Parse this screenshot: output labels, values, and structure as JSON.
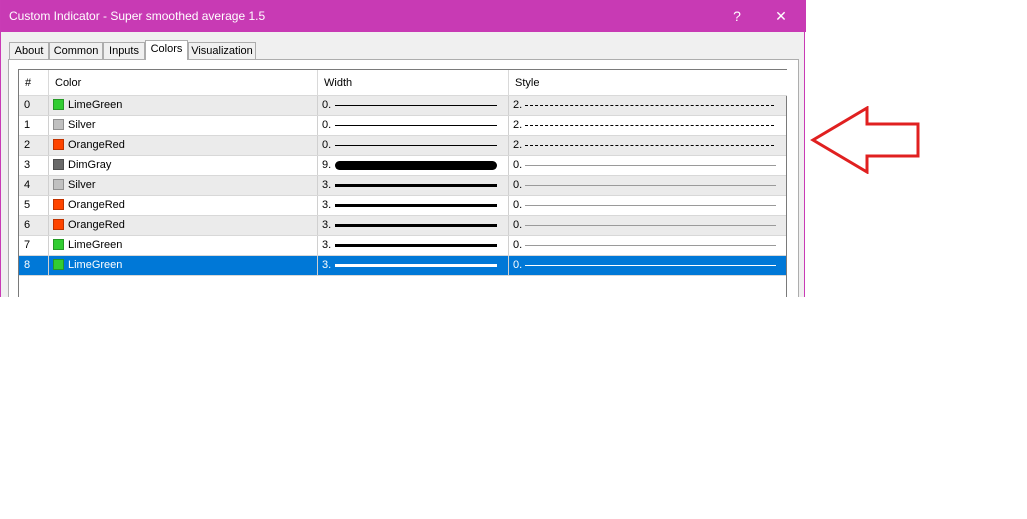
{
  "window": {
    "title": "Custom Indicator - Super smoothed average 1.5",
    "help_label": "?",
    "close_label": "✕"
  },
  "tabs": [
    {
      "label": "About"
    },
    {
      "label": "Common"
    },
    {
      "label": "Inputs"
    },
    {
      "label": "Colors"
    },
    {
      "label": "Visualization"
    }
  ],
  "active_tab": "Colors",
  "table": {
    "headers": [
      "#",
      "Color",
      "Width",
      "Style"
    ],
    "rows": [
      {
        "index": "0",
        "color_name": "LimeGreen",
        "color_hex": "#32cd32",
        "width": "0.",
        "style": "2."
      },
      {
        "index": "1",
        "color_name": "Silver",
        "color_hex": "#c0c0c0",
        "width": "0.",
        "style": "2."
      },
      {
        "index": "2",
        "color_name": "OrangeRed",
        "color_hex": "#ff4500",
        "width": "0.",
        "style": "2."
      },
      {
        "index": "3",
        "color_name": "DimGray",
        "color_hex": "#696969",
        "width": "9.",
        "style": "0."
      },
      {
        "index": "4",
        "color_name": "Silver",
        "color_hex": "#c0c0c0",
        "width": "3.",
        "style": "0."
      },
      {
        "index": "5",
        "color_name": "OrangeRed",
        "color_hex": "#ff4500",
        "width": "3.",
        "style": "0."
      },
      {
        "index": "6",
        "color_name": "OrangeRed",
        "color_hex": "#ff4500",
        "width": "3.",
        "style": "0."
      },
      {
        "index": "7",
        "color_name": "LimeGreen",
        "color_hex": "#32cd32",
        "width": "3.",
        "style": "0."
      },
      {
        "index": "8",
        "color_name": "LimeGreen",
        "color_hex": "#32cd32",
        "width": "3.",
        "style": "0."
      }
    ],
    "selected_row": "8"
  },
  "colors": {
    "titlebar": "#c83ab4",
    "selection": "#0078d7",
    "arrow": "#e02020"
  }
}
